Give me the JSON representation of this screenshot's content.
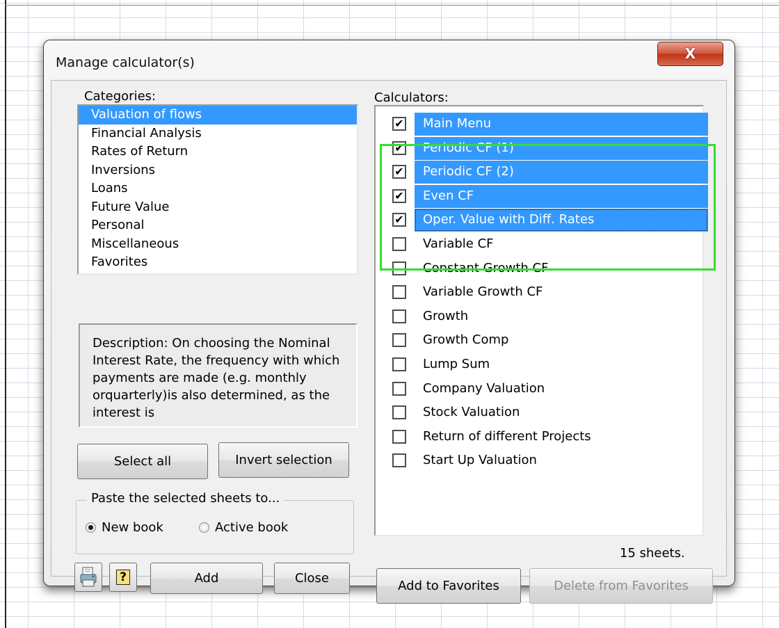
{
  "dialog": {
    "title": "Manage calculator(s)",
    "close_glyph": "X"
  },
  "categories": {
    "label": "Categories:",
    "items": [
      "Valuation of flows",
      "Financial Analysis",
      "Rates of Return",
      "Inversions",
      "Loans",
      "Future Value",
      "Personal",
      "Miscellaneous",
      "Favorites"
    ],
    "selected": "Valuation of flows"
  },
  "description": "Description: On choosing the Nominal Interest Rate, the frequency with which payments are made (e.g. monthly orquarterly)is also determined, as the interest is",
  "buttons": {
    "select_all": "Select all",
    "invert_selection": "Invert selection",
    "add": "Add",
    "close": "Close",
    "add_to_favorites": "Add to Favorites",
    "delete_from_favorites": "Delete from Favorites",
    "help_glyph": "?"
  },
  "paste_group": {
    "legend": "Paste the selected sheets to...",
    "new_book": "New book",
    "active_book": "Active book",
    "selected_option": "New book"
  },
  "calculators": {
    "label": "Calculators:",
    "items": [
      {
        "name": "Main Menu",
        "checked": true
      },
      {
        "name": "Periodic CF (1)",
        "checked": true
      },
      {
        "name": "Periodic CF (2)",
        "checked": true
      },
      {
        "name": "Even CF",
        "checked": true
      },
      {
        "name": "Oper. Value with Diff. Rates",
        "checked": true
      },
      {
        "name": "Variable CF",
        "checked": false
      },
      {
        "name": "Constant Growth CF",
        "checked": false
      },
      {
        "name": "Variable Growth CF",
        "checked": false
      },
      {
        "name": "Growth",
        "checked": false
      },
      {
        "name": "Growth Comp",
        "checked": false
      },
      {
        "name": "Lump Sum",
        "checked": false
      },
      {
        "name": "Company Valuation",
        "checked": false
      },
      {
        "name": "Stock Valuation",
        "checked": false
      },
      {
        "name": "Return of different Projects",
        "checked": false
      },
      {
        "name": "Start Up Valuation",
        "checked": false
      }
    ],
    "focused": "Oper. Value with Diff. Rates"
  },
  "sheet_count": "15 sheets.",
  "icons": {
    "close": "close-icon",
    "printer": "printer-icon",
    "help": "help-icon",
    "check": "checkmark-icon"
  },
  "colors": {
    "selection": "#3399ff",
    "highlight_box": "#33dd33",
    "close_button": "#c83a1d"
  }
}
